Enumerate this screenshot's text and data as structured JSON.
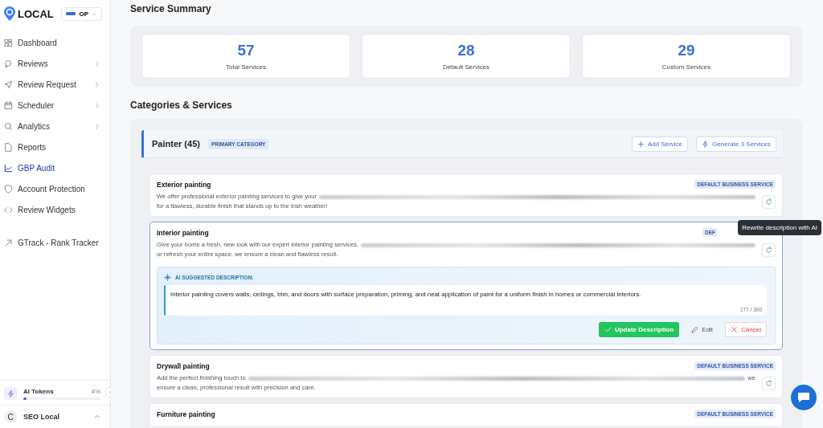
{
  "sidebar": {
    "logo": "LOCAL",
    "account_chip": "OP",
    "items": [
      {
        "label": "Dashboard",
        "selected": false,
        "has_submenu": false
      },
      {
        "label": "Reviews",
        "selected": false,
        "has_submenu": true
      },
      {
        "label": "Review Request",
        "selected": false,
        "has_submenu": true
      },
      {
        "label": "Scheduler",
        "selected": false,
        "has_submenu": true
      },
      {
        "label": "Analytics",
        "selected": false,
        "has_submenu": true
      },
      {
        "label": "Reports",
        "selected": false,
        "has_submenu": false
      },
      {
        "label": "GBP Audit",
        "selected": true,
        "has_submenu": false
      },
      {
        "label": "Account Protection",
        "selected": false,
        "has_submenu": false
      },
      {
        "label": "Review Widgets",
        "selected": false,
        "has_submenu": false
      },
      {
        "label": "GTrack - Rank Tracker",
        "selected": false,
        "has_submenu": false
      }
    ],
    "tokens": {
      "label": "AI Tokens",
      "reading": "4%",
      "level": 0.04
    },
    "user": {
      "initial": "C",
      "name": "SEO Local"
    }
  },
  "summary": {
    "title": "Service Summary",
    "stats": [
      {
        "value": "57",
        "label": "Total Services"
      },
      {
        "value": "28",
        "label": "Default Services"
      },
      {
        "value": "29",
        "label": "Custom Services"
      }
    ]
  },
  "categories": {
    "title": "Categories & Services",
    "category": {
      "name": "Painter (45)",
      "badge": "PRIMARY CATEGORY",
      "actions": [
        {
          "label": "Add Service"
        },
        {
          "label": "Generate 3 Services"
        }
      ],
      "services": [
        {
          "name": "Exterior painting",
          "badge": "DEFAULT BUSINESS SERVICE",
          "selected": false,
          "line1_lead": "We offer professional exterior painting services to give your",
          "line2": "for a flawless, durable finish that stands up to the Irish weather!"
        },
        {
          "name": "Interior painting",
          "badge": "DEF",
          "selected": true,
          "line1_lead": "Give your home a fresh, new look with our expert interior painting services.",
          "line2": "or refresh your entire space, we ensure a clean and flawless result.",
          "tooltip": "Rewrite description with AI",
          "suggestion": {
            "label": "AI SUGGESTED DESCRIPTION:",
            "text": "Interior painting covers walls, ceilings, trim, and doors with surface preparation, priming, and neat application of paint for a uniform finish in homes or commercial interiors.",
            "count": "177 / 300",
            "buttons": [
              {
                "label": "Update Description",
                "kind": "primary"
              },
              {
                "label": "Edit",
                "kind": "plain"
              },
              {
                "label": "Cancel",
                "kind": "danger"
              }
            ]
          }
        },
        {
          "name": "Drywall painting",
          "badge": "DEFAULT BUSINESS SERVICE",
          "selected": false,
          "line1_lead": "Add the perfect finishing touch to",
          "line1_end": "we",
          "line2": "ensure a clean, professional result with precision and care."
        },
        {
          "name": "Furniture painting",
          "badge": "DEFAULT BUSINESS SERVICE",
          "selected": false
        }
      ]
    }
  }
}
